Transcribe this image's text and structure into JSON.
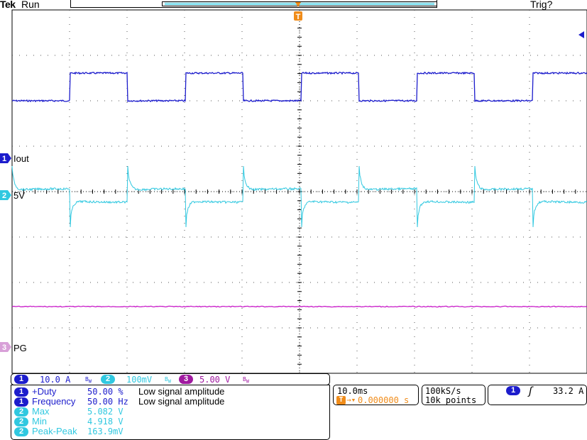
{
  "header": {
    "brand": "Tek",
    "run_state": "Run",
    "trigger_state": "Trig?"
  },
  "channels": [
    {
      "id": "1",
      "label": "Iout",
      "color": "#1c1ccc",
      "scale": "10.0 A"
    },
    {
      "id": "2",
      "label": "5V",
      "color": "#30c8e0",
      "scale": "100mV"
    },
    {
      "id": "3",
      "label": "PG",
      "color": "#c81ac8",
      "scale": "5.00 V"
    }
  ],
  "vertical": {
    "ch1_num": "1",
    "ch1_scale": "10.0 A",
    "ch2_num": "2",
    "ch2_scale": "100mV",
    "ch3_num": "3",
    "ch3_scale": "5.00 V",
    "bw_icon": "bandwidth-limit-icon"
  },
  "measurements": [
    {
      "ch": "1",
      "name": "+Duty",
      "value": "50.00 %",
      "note": "Low signal amplitude",
      "color": "#1c1ccc"
    },
    {
      "ch": "1",
      "name": "Frequency",
      "value": "50.00 Hz",
      "note": "Low signal amplitude",
      "color": "#1c1ccc"
    },
    {
      "ch": "2",
      "name": "Max",
      "value": "5.082 V",
      "note": "",
      "color": "#30c8e0"
    },
    {
      "ch": "2",
      "name": "Min",
      "value": "4.918 V",
      "note": "",
      "color": "#30c8e0"
    },
    {
      "ch": "2",
      "name": "Peak-Peak",
      "value": "163.9mV",
      "note": "",
      "color": "#30c8e0"
    }
  ],
  "timebase": {
    "scale": "10.0ms",
    "position": "0.000000 s",
    "marker_icon": "trigger-position-icon"
  },
  "acquisition": {
    "sample_rate": "100kS/s",
    "record_length": "10k points"
  },
  "trigger": {
    "source": "1",
    "slope_icon": "rising-edge-icon",
    "level": "33.2 A"
  },
  "markers": {
    "trigger_marker": "T",
    "trigger_level_icon": "arrow-left-icon"
  },
  "colors": {
    "ch1": "#1c1ccc",
    "ch2": "#30c8e0",
    "ch3": "#c81ac8",
    "trigger": "#f08c1a",
    "grid": "#000000"
  }
}
